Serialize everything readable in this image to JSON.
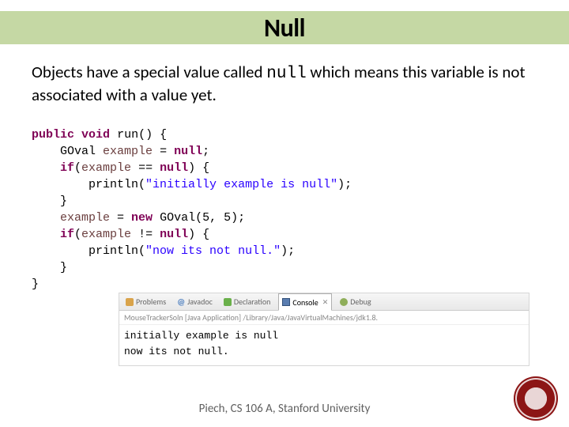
{
  "title": "Null",
  "description": {
    "pre": "Objects have a special value called ",
    "code": "null",
    "post": " which means this variable is not associated with a value yet."
  },
  "code": {
    "l1": {
      "kw1": "public",
      "kw2": "void",
      "name": "run",
      "tail": "() {"
    },
    "l2": {
      "type": "GOval",
      "name": "example",
      "eq": " = ",
      "kw": "null",
      "semi": ";"
    },
    "l3": {
      "kw_if": "if",
      "open": "(",
      "name": "example",
      "op": " == ",
      "kw_null": "null",
      "close": ") {"
    },
    "l4": {
      "fn": "println",
      "open": "(",
      "str": "\"initially example is null\"",
      "close": ");"
    },
    "l5": "}",
    "l6": {
      "name": "example",
      "eq": " = ",
      "kw_new": "new",
      "ctor": " GOval(5, 5);"
    },
    "l7": {
      "kw_if": "if",
      "open": "(",
      "name": "example",
      "op": " != ",
      "kw_null": "null",
      "close": ") {"
    },
    "l8": {
      "fn": "println",
      "open": "(",
      "str": "\"now its not null.\"",
      "close": ");"
    },
    "l9": "}",
    "l10": "}"
  },
  "tabs": {
    "problems": "Problems",
    "javadoc": "Javadoc",
    "declaration": "Declaration",
    "console": "Console",
    "console_x": "✕",
    "debug": "Debug"
  },
  "console": {
    "meta": "MouseTrackerSoln [Java Application] /Library/Java/JavaVirtualMachines/jdk1.8.",
    "line1": "initially example is null",
    "line2": "now its not null."
  },
  "footer": "Piech, CS 106 A, Stanford University"
}
